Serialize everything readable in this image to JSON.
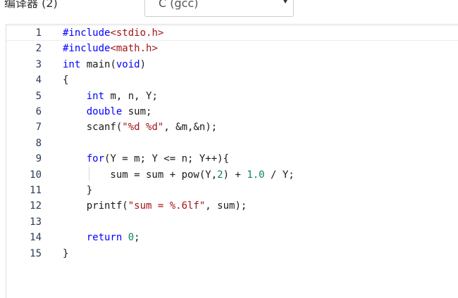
{
  "toolbar": {
    "compiler_label": "编译器 (2)",
    "compiler_selected": "C (gcc)"
  },
  "editor": {
    "lines": [
      {
        "num": "1",
        "tokens": [
          {
            "t": "#include",
            "c": "kw"
          },
          {
            "t": "<stdio.h>",
            "c": "str"
          }
        ]
      },
      {
        "num": "2",
        "tokens": [
          {
            "t": "#include",
            "c": "kw"
          },
          {
            "t": "<math.h>",
            "c": "str"
          }
        ]
      },
      {
        "num": "3",
        "tokens": [
          {
            "t": "int",
            "c": "kw"
          },
          {
            "t": " main(",
            "c": "plain"
          },
          {
            "t": "void",
            "c": "kw"
          },
          {
            "t": ")",
            "c": "plain"
          }
        ]
      },
      {
        "num": "4",
        "tokens": [
          {
            "t": "{",
            "c": "plain"
          }
        ]
      },
      {
        "num": "5",
        "tokens": [
          {
            "t": "    ",
            "c": "plain"
          },
          {
            "t": "int",
            "c": "kw"
          },
          {
            "t": " m, n, Y;",
            "c": "plain"
          }
        ]
      },
      {
        "num": "6",
        "tokens": [
          {
            "t": "    ",
            "c": "plain"
          },
          {
            "t": "double",
            "c": "kw"
          },
          {
            "t": " sum;",
            "c": "plain"
          }
        ]
      },
      {
        "num": "7",
        "tokens": [
          {
            "t": "    scanf(",
            "c": "plain"
          },
          {
            "t": "\"%d %d\"",
            "c": "str"
          },
          {
            "t": ", &m,&n);",
            "c": "plain"
          }
        ]
      },
      {
        "num": "8",
        "tokens": []
      },
      {
        "num": "9",
        "tokens": [
          {
            "t": "    ",
            "c": "plain"
          },
          {
            "t": "for",
            "c": "kw"
          },
          {
            "t": "(Y = m; Y <= n; Y++){",
            "c": "plain"
          }
        ]
      },
      {
        "num": "10",
        "tokens": [
          {
            "t": "        sum = sum + pow(Y,",
            "c": "plain"
          },
          {
            "t": "2",
            "c": "num"
          },
          {
            "t": ") + ",
            "c": "plain"
          },
          {
            "t": "1.0",
            "c": "num"
          },
          {
            "t": " / Y;",
            "c": "plain"
          }
        ]
      },
      {
        "num": "11",
        "tokens": [
          {
            "t": "    }",
            "c": "plain"
          }
        ]
      },
      {
        "num": "12",
        "tokens": [
          {
            "t": "    printf(",
            "c": "plain"
          },
          {
            "t": "\"sum = %.6lf\"",
            "c": "str"
          },
          {
            "t": ", sum);",
            "c": "plain"
          }
        ]
      },
      {
        "num": "13",
        "tokens": []
      },
      {
        "num": "14",
        "tokens": [
          {
            "t": "    ",
            "c": "plain"
          },
          {
            "t": "return",
            "c": "kw"
          },
          {
            "t": " ",
            "c": "plain"
          },
          {
            "t": "0",
            "c": "num"
          },
          {
            "t": ";",
            "c": "plain"
          }
        ]
      },
      {
        "num": "15",
        "tokens": [
          {
            "t": "}",
            "c": "plain"
          }
        ]
      }
    ]
  },
  "colors": {
    "keyword": "#0000ff",
    "string": "#a31515",
    "number": "#098658",
    "line_number": "#2b3a55"
  }
}
